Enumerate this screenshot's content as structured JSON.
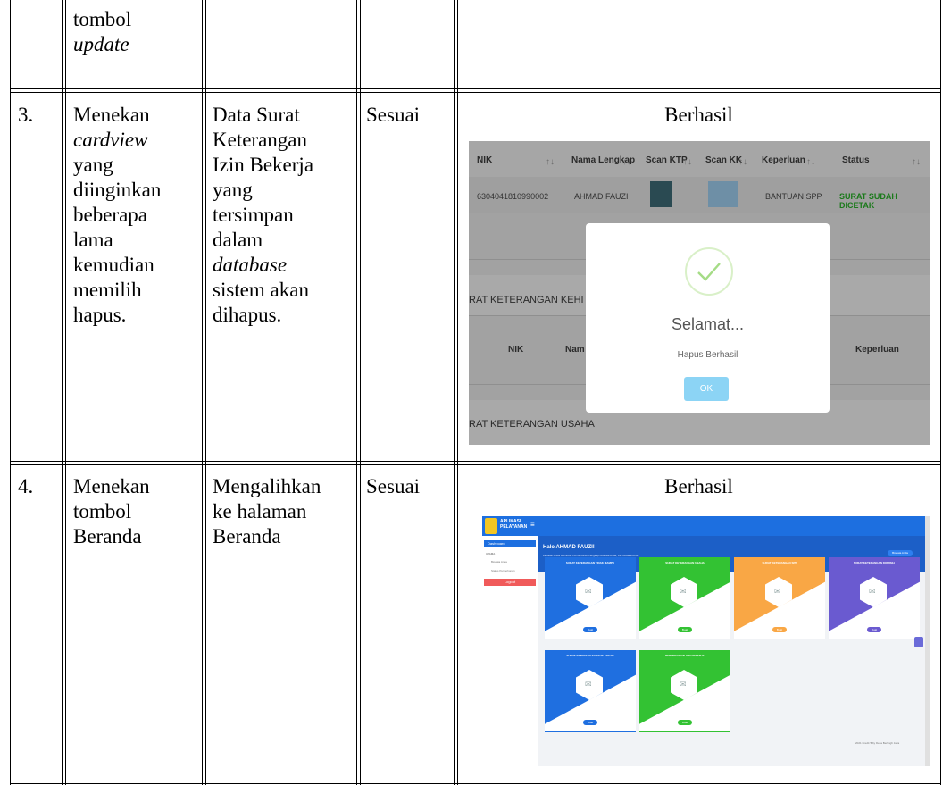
{
  "rows": [
    {
      "col2": [
        "tombol",
        "update"
      ],
      "col2_italic": [
        false,
        true
      ]
    },
    {
      "no": "3.",
      "action": [
        "Menekan",
        "cardview",
        "yang",
        "diinginkan",
        "beberapa",
        "lama",
        "kemudian",
        "memilih",
        "hapus."
      ],
      "action_italic": [
        false,
        true,
        false,
        false,
        false,
        false,
        false,
        false,
        false
      ],
      "expected": [
        "Data Surat",
        "Keterangan",
        "Izin Bekerja",
        "yang",
        "tersimpan",
        "dalam",
        "database",
        "sistem akan",
        "dihapus."
      ],
      "expected_italic": [
        false,
        false,
        false,
        false,
        false,
        false,
        true,
        false,
        false
      ],
      "conclusion": "Sesuai",
      "result_title": "Berhasil",
      "screenshot": {
        "headers": [
          "NIK",
          "Nama Lengkap",
          "Scan KTP",
          "Scan KK",
          "Keperluan",
          "Status"
        ],
        "sort_glyph": "↑↓",
        "row": {
          "nik": "6304041810990002",
          "nama": "AHMAD FAUZI",
          "keperluan": "BANTUAN SPP",
          "status": "SURAT SUDAH DICETAK"
        },
        "section_1": "RAT KETERANGAN KEHI",
        "section_1_headers": [
          "NIK",
          "Nam",
          "Keperluan"
        ],
        "section_2": "RAT KETERANGAN USAHA",
        "modal": {
          "title": "Selamat...",
          "message": "Hapus Berhasil",
          "ok_label": "OK"
        }
      }
    },
    {
      "no": "4.",
      "action": [
        "Menekan",
        "tombol",
        "Beranda"
      ],
      "expected": [
        "Mengalihkan",
        "ke halaman",
        "Beranda"
      ],
      "conclusion": "Sesuai",
      "result_title": "Berhasil",
      "screenshot": {
        "app_name": [
          "APLIKASI",
          "PELAYANAN"
        ],
        "menu": [
          "Dashboard",
          "UTAMA",
          "Biodata Anda",
          "Status Permohonan",
          "Logout"
        ],
        "greeting": "Halo AHMAD FAUZI!",
        "greeting_sub": "Lakukan Anda Membuat Permohonan Lengkapi Biodata Anda, Klik Biodata Anda",
        "profile_button": "Biodata Anda",
        "cards": [
          {
            "title": "SURAT KETERANGAN TIDAK MAMPU",
            "button": "Buat",
            "color": "#1f6fe0"
          },
          {
            "title": "SURAT KETERANGAN USAHA",
            "button": "Buat",
            "color": "#33c233"
          },
          {
            "title": "SURAT KETERANGAN SPP",
            "button": "Buat",
            "color": "#f9a745"
          },
          {
            "title": "SURAT KETERANGAN DOMISILI",
            "button": "Buat",
            "color": "#6a5ad0"
          },
          {
            "title": "SURAT KETERANGAN KEHILANGAN",
            "button": "Buat",
            "color": "#1f6fe0"
          },
          {
            "title": "PERMOHONAN IZIN BEKERJA",
            "button": "Buat",
            "color": "#33c233"
          }
        ],
        "footer": "2021 Credit ♥ by Desa Bertingh Jaya"
      }
    }
  ]
}
